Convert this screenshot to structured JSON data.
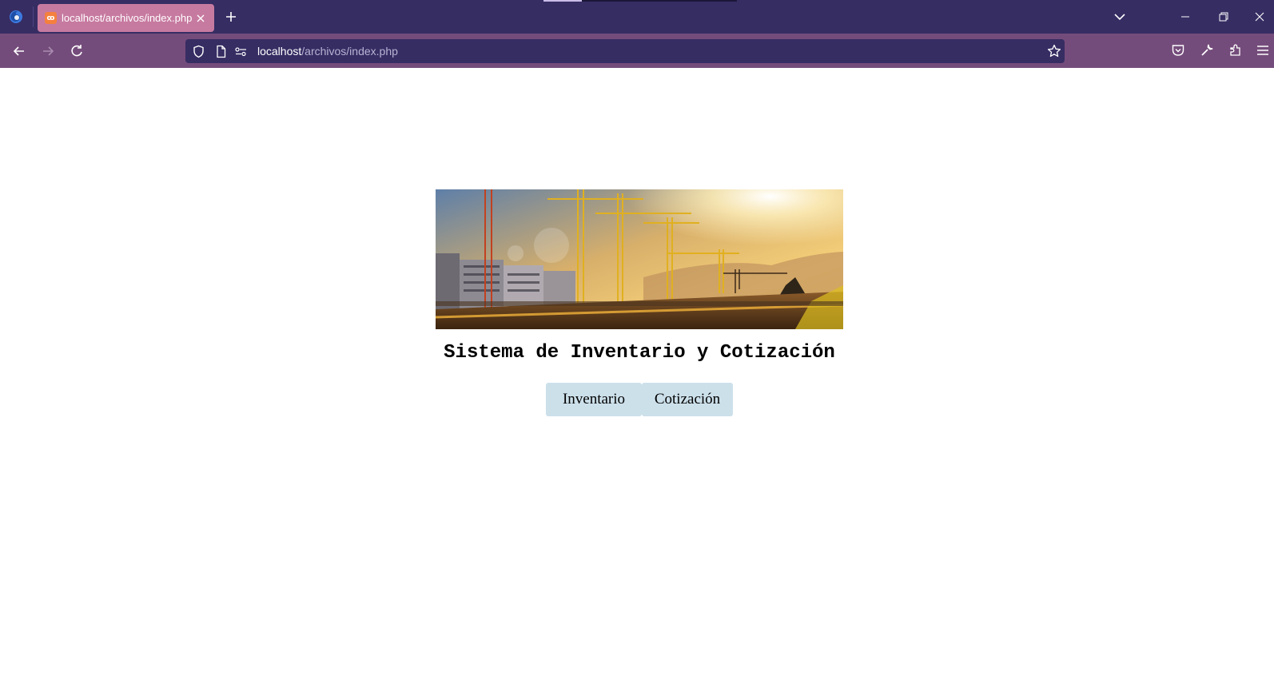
{
  "browser": {
    "tab": {
      "title": "localhost/archivos/index.php",
      "favicon": "xampp-icon"
    },
    "url": {
      "host": "localhost",
      "path": "/archivos/index.php"
    },
    "colors": {
      "tabstrip": "#362d63",
      "toolbar": "#744c7b",
      "active_tab": "#c77aa0",
      "urlbar": "#362d63"
    }
  },
  "page": {
    "hero_image": "construction-site-cranes-sunrise",
    "title": "Sistema de Inventario y Cotización",
    "buttons": {
      "inventario": "Inventario",
      "cotizacion": "Cotización"
    },
    "colors": {
      "button_bg": "#cce0ea"
    }
  }
}
